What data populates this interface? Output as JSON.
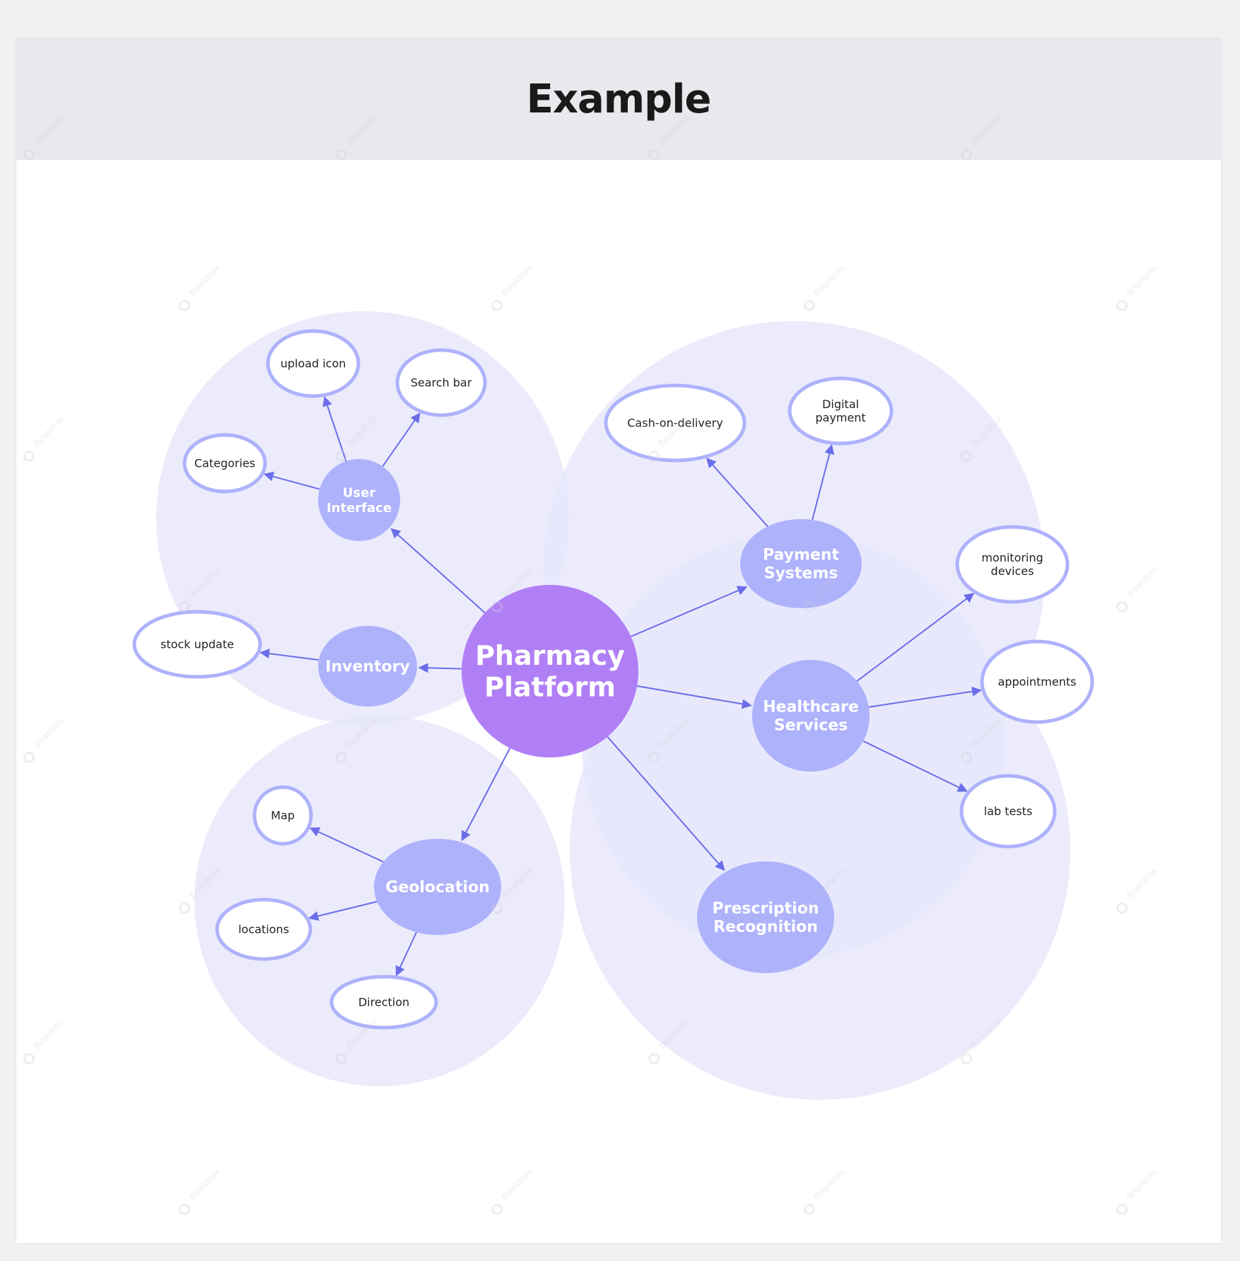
{
  "header": {
    "title": "Example"
  },
  "watermark": {
    "text": "Boardmix",
    "icon": "boardmix-logo-icon"
  },
  "colors": {
    "cluster_fill": "#e7e7fb",
    "center_fill": "#b07ff5",
    "hub_fill": "#aeb2fb",
    "leaf_stroke": "#aeb2fb",
    "edge": "#6b6ee8"
  },
  "diagram": {
    "center": {
      "label": [
        "Pharmacy",
        "Platform"
      ]
    },
    "hubs": [
      {
        "id": "user_interface",
        "label": [
          "User",
          "Interface"
        ]
      },
      {
        "id": "inventory",
        "label": [
          "Inventory"
        ]
      },
      {
        "id": "payment",
        "label": [
          "Payment",
          "Systems"
        ]
      },
      {
        "id": "healthcare",
        "label": [
          "Healthcare",
          "Services"
        ]
      },
      {
        "id": "geolocation",
        "label": [
          "Geolocation"
        ]
      },
      {
        "id": "prescription",
        "label": [
          "Prescription",
          "Recognition"
        ]
      }
    ],
    "leaves": [
      {
        "id": "upload_icon",
        "label": [
          "upload icon"
        ]
      },
      {
        "id": "search_bar",
        "label": [
          "Search bar"
        ]
      },
      {
        "id": "categories",
        "label": [
          "Categories"
        ]
      },
      {
        "id": "stock_update",
        "label": [
          "stock update"
        ]
      },
      {
        "id": "cash_on_delivery",
        "label": [
          "Cash-on-delivery"
        ]
      },
      {
        "id": "digital_payment",
        "label": [
          "Digital",
          "payment"
        ]
      },
      {
        "id": "monitoring_devices",
        "label": [
          "monitoring",
          "devices"
        ]
      },
      {
        "id": "appointments",
        "label": [
          "appointments"
        ]
      },
      {
        "id": "lab_tests",
        "label": [
          "lab tests"
        ]
      },
      {
        "id": "map",
        "label": [
          "Map"
        ]
      },
      {
        "id": "locations",
        "label": [
          "locations"
        ]
      },
      {
        "id": "direction",
        "label": [
          "Direction"
        ]
      }
    ],
    "edges": [
      {
        "from": "center",
        "to": "user_interface"
      },
      {
        "from": "center",
        "to": "inventory"
      },
      {
        "from": "center",
        "to": "payment"
      },
      {
        "from": "center",
        "to": "healthcare"
      },
      {
        "from": "center",
        "to": "geolocation"
      },
      {
        "from": "center",
        "to": "prescription"
      },
      {
        "from": "user_interface",
        "to": "upload_icon"
      },
      {
        "from": "user_interface",
        "to": "search_bar"
      },
      {
        "from": "user_interface",
        "to": "categories"
      },
      {
        "from": "inventory",
        "to": "stock_update"
      },
      {
        "from": "payment",
        "to": "cash_on_delivery"
      },
      {
        "from": "payment",
        "to": "digital_payment"
      },
      {
        "from": "healthcare",
        "to": "monitoring_devices"
      },
      {
        "from": "healthcare",
        "to": "appointments"
      },
      {
        "from": "healthcare",
        "to": "lab_tests"
      },
      {
        "from": "geolocation",
        "to": "map"
      },
      {
        "from": "geolocation",
        "to": "locations"
      },
      {
        "from": "geolocation",
        "to": "direction"
      }
    ]
  }
}
